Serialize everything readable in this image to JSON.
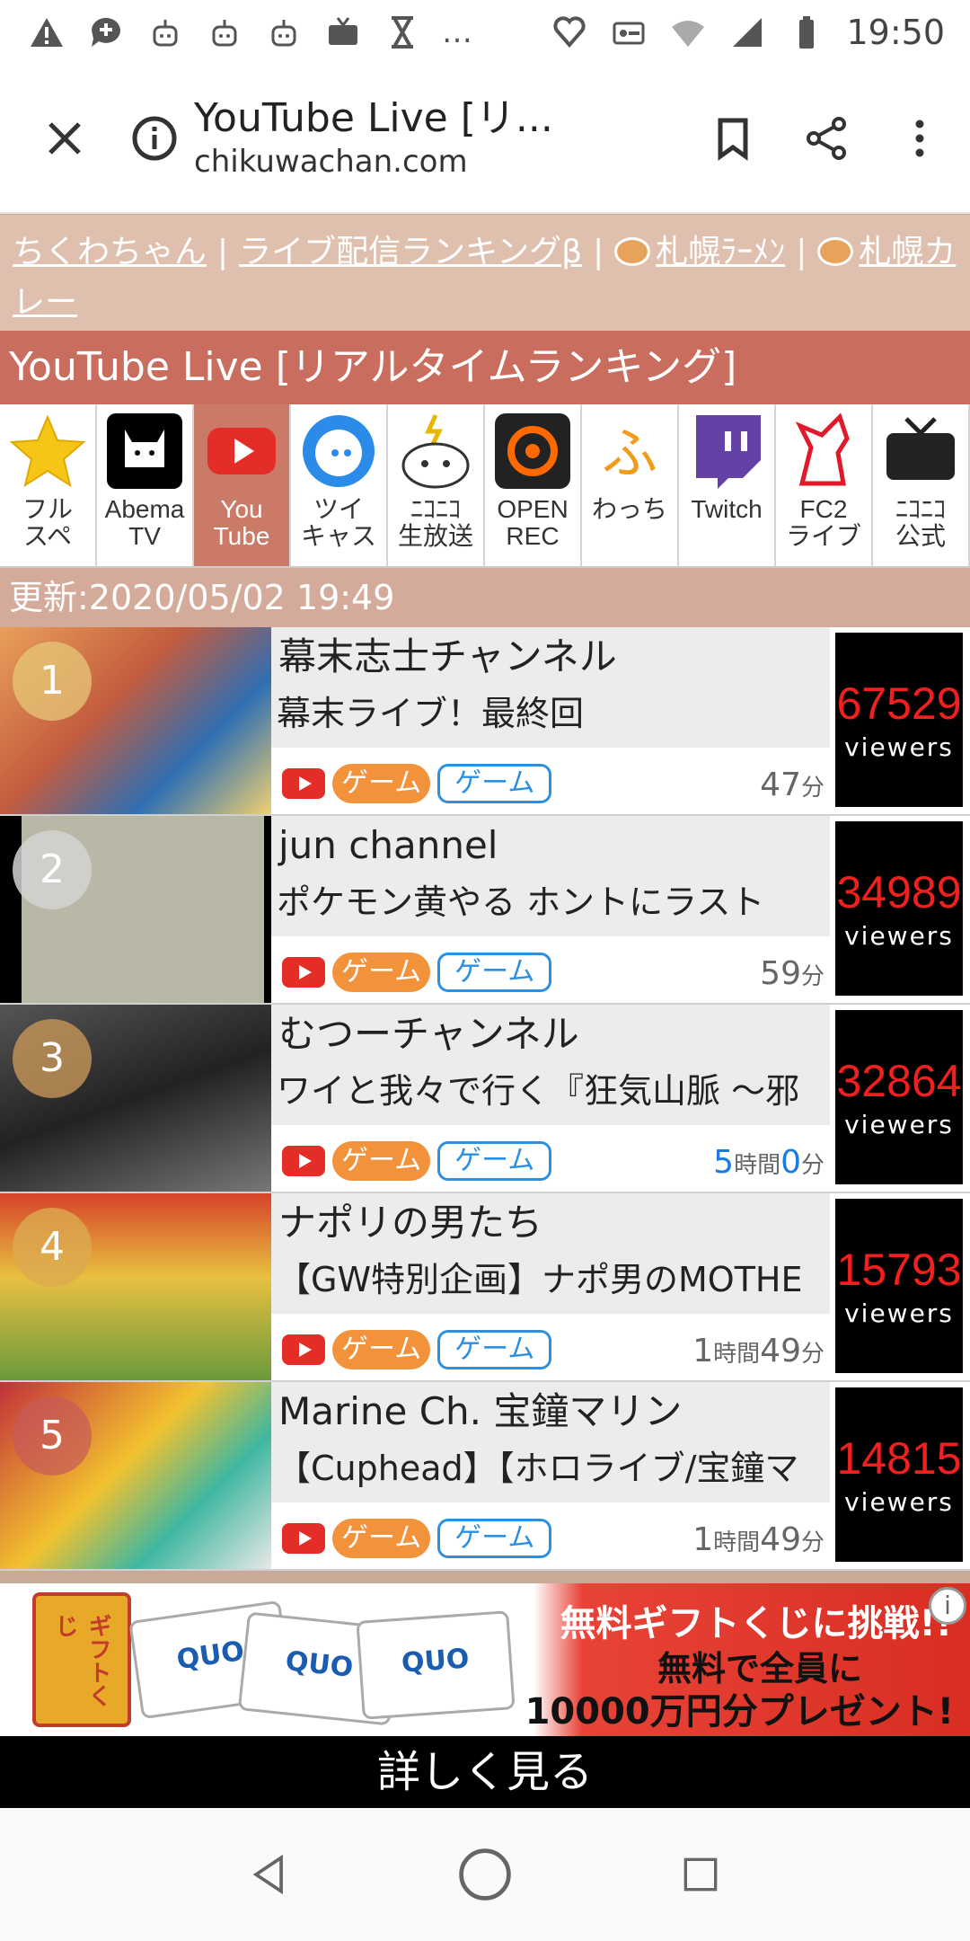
{
  "status_bar": {
    "time": "19:50",
    "more": "…"
  },
  "browser": {
    "title": "YouTube Live [リ...",
    "url": "chikuwachan.com"
  },
  "site_nav": {
    "links": [
      "ちくわちゃん",
      "ライブ配信ランキングβ",
      "札幌ﾗｰﾒﾝ",
      "札幌カレー"
    ],
    "separator": "|"
  },
  "heading": "YouTube Live [リアルタイムランキング]",
  "tabs": [
    {
      "label": "フル\nスペ",
      "icon": "star-icon"
    },
    {
      "label": "Abema\nTV",
      "icon": "abema-icon"
    },
    {
      "label": "You\nTube",
      "icon": "youtube-icon",
      "active": true
    },
    {
      "label": "ツイ\nキャス",
      "icon": "twitcasting-icon"
    },
    {
      "label": "ﾆｺﾆｺ\n生放送",
      "icon": "niconico-live-icon"
    },
    {
      "label": "OPEN\nREC",
      "icon": "openrec-icon"
    },
    {
      "label": "わっち",
      "icon": "watch-icon"
    },
    {
      "label": "Twitch",
      "icon": "twitch-icon"
    },
    {
      "label": "FC2\nライブ",
      "icon": "fc2-icon"
    },
    {
      "label": "ﾆｺﾆｺ\n公式",
      "icon": "niconico-official-icon"
    }
  ],
  "updated": "更新:2020/05/02 19:49",
  "tag_game_orange": "ゲーム",
  "tag_game_outline": "ゲーム",
  "viewers_label": "viewers",
  "streams": [
    {
      "rank": "1",
      "channel": "幕末志士チャンネル",
      "title": "幕末ライブ！最終回",
      "viewers": "67529",
      "dur_num": "47",
      "dur_unit": "分",
      "thumb_color": "#2f6fb3"
    },
    {
      "rank": "2",
      "channel": "jun channel",
      "title": "ポケモン黄やる ホントにラスト",
      "viewers": "34989",
      "dur_num": "59",
      "dur_unit": "分",
      "thumb_color": "#b8b8a8"
    },
    {
      "rank": "3",
      "channel": "むつーチャンネル",
      "title": "ワイと我々で行く『狂気山脈 ～邪",
      "viewers": "32864",
      "dur_h": "5",
      "dur_h_unit": "時間",
      "dur_num": "0",
      "dur_unit": "分",
      "thumb_color": "#3a3a3a"
    },
    {
      "rank": "4",
      "channel": "ナポリの男たち",
      "title": "【GW特別企画】ナポ男のMOTHE",
      "viewers": "15793",
      "dur_h": "1",
      "dur_h_unit": "時間",
      "dur_num": "49",
      "dur_unit": "分",
      "thumb_color": "#d6432a"
    },
    {
      "rank": "5",
      "channel": "Marine Ch. 宝鐘マリン",
      "title": "【Cuphead】【ホロライブ/宝鐘マ",
      "viewers": "14815",
      "dur_h": "1",
      "dur_h_unit": "時間",
      "dur_num": "49",
      "dur_unit": "分",
      "thumb_color": "#c2303a"
    }
  ],
  "ad": {
    "line1": "無料ギフトくじに挑戦!!",
    "line2": "無料で全員に",
    "line3": "10000万円分プレゼント!",
    "box_text": "ギフトくじ",
    "card_text": "QUO",
    "info": "i",
    "cta": "詳しく見る"
  },
  "colors": {
    "accent_heading": "#c96e5f",
    "nav_bg": "#dfc0ae",
    "viewer_count": "#f21f1f",
    "tag_blue": "#2c8fe0",
    "tag_orange": "#f2923a"
  }
}
